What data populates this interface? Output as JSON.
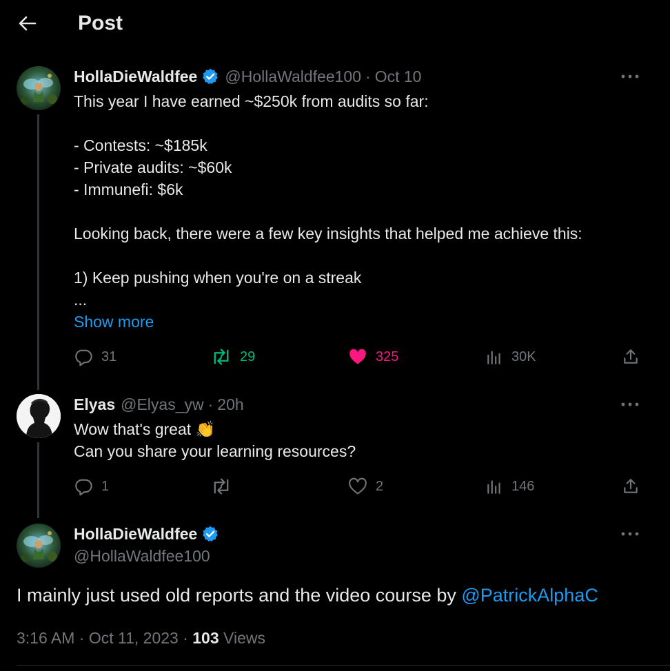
{
  "header": {
    "title": "Post"
  },
  "parent_tweet": {
    "name": "HollaDieWaldfee",
    "handle": "@HollaWaldfee100",
    "time": "Oct 10",
    "lines": [
      "This year I have earned ~$250k from audits so far:",
      "",
      "- Contests: ~$185k",
      "- Private audits: ~$60k",
      "- Immunefi: $6k",
      "",
      "Looking back, there were a few key insights that helped me achieve this:",
      "",
      "1) Keep pushing when you're on a streak",
      "..."
    ],
    "show_more": "Show more",
    "stats": {
      "replies": "31",
      "reposts": "29",
      "likes": "325",
      "views": "30K"
    }
  },
  "reply_tweet": {
    "name": "Elyas",
    "handle": "@Elyas_yw",
    "time": "20h",
    "line1": "Wow that's great",
    "emoji": "👏",
    "line2": "Can you share your learning resources?",
    "stats": {
      "replies": "1",
      "reposts": "",
      "likes": "2",
      "views": "146"
    }
  },
  "main_tweet": {
    "name": "HollaDieWaldfee",
    "handle": "@HollaWaldfee100",
    "text": "I mainly just used old reports and the video course by ",
    "mention": "@PatrickAlphaC",
    "timestamp": "3:16 AM · Oct 11, 2023 · ",
    "views_count": "103",
    "views_label": " Views"
  },
  "colors": {
    "background": "#000000",
    "text": "#e7e9ea",
    "muted": "#71767b",
    "link": "#1d9bf0",
    "repost_active": "#00ba7c",
    "like_active": "#f91880"
  }
}
